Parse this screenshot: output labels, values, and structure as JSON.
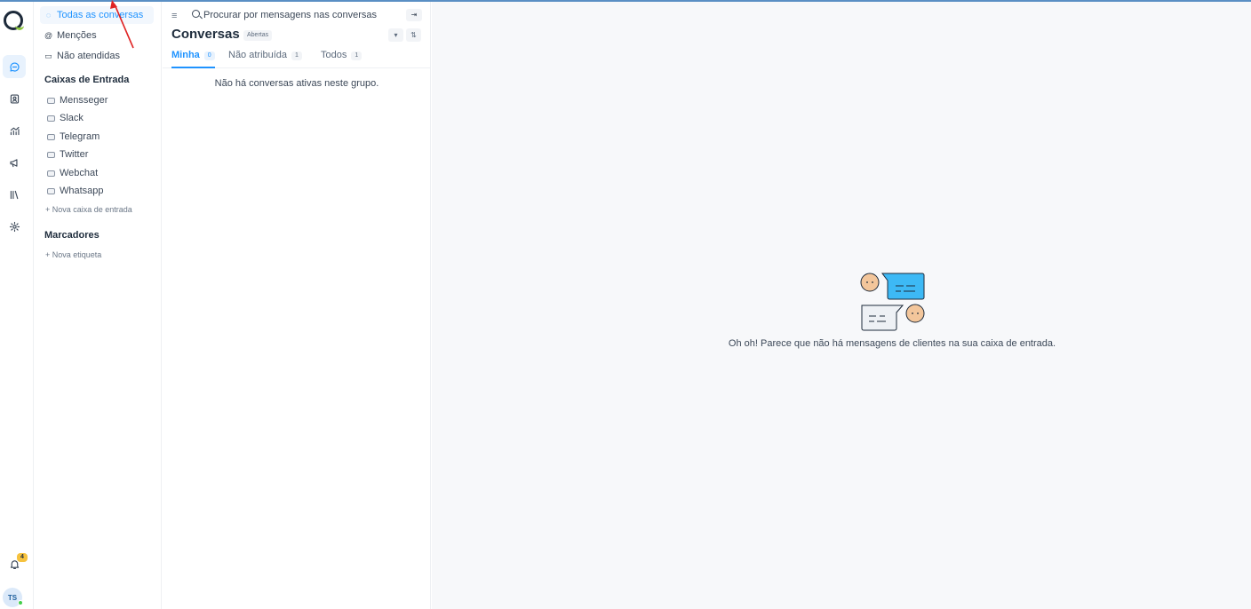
{
  "rail": {
    "icons": [
      "logo",
      "conversations-icon",
      "contacts-icon",
      "reports-icon",
      "campaigns-icon",
      "library-icon",
      "settings-icon",
      "bell-icon"
    ],
    "notification_count": "4",
    "avatar_initials": "TS"
  },
  "sidebar": {
    "nav": [
      {
        "label": "Todas as conversas",
        "icon": "chat-icon",
        "active": true
      },
      {
        "label": "Menções",
        "icon": "at-icon"
      },
      {
        "label": "Não atendidas",
        "icon": "inbox-icon"
      }
    ],
    "inboxes_title": "Caixas de Entrada",
    "inboxes": [
      "Mensseger",
      "Slack",
      "Telegram",
      "Twitter",
      "Webchat",
      "Whatsapp"
    ],
    "new_inbox": "+ Nova caixa de entrada",
    "labels_title": "Marcadores",
    "new_label": "+ Nova etiqueta"
  },
  "conversations": {
    "search_placeholder": "Procurar por mensagens nas conversas",
    "title": "Conversas",
    "status": "Abertas",
    "tabs": [
      {
        "label": "Minha",
        "count": "0",
        "active": true
      },
      {
        "label": "Não atribuída",
        "count": "1"
      },
      {
        "label": "Todos",
        "count": "1"
      }
    ],
    "empty_text": "Não há conversas ativas neste grupo."
  },
  "main": {
    "empty_text": "Oh oh! Parece que não há mensagens de clientes na sua caixa de entrada."
  },
  "colors": {
    "accent": "#1f93ff",
    "annotation": "#e02424",
    "bubble": "#3db9f5"
  }
}
